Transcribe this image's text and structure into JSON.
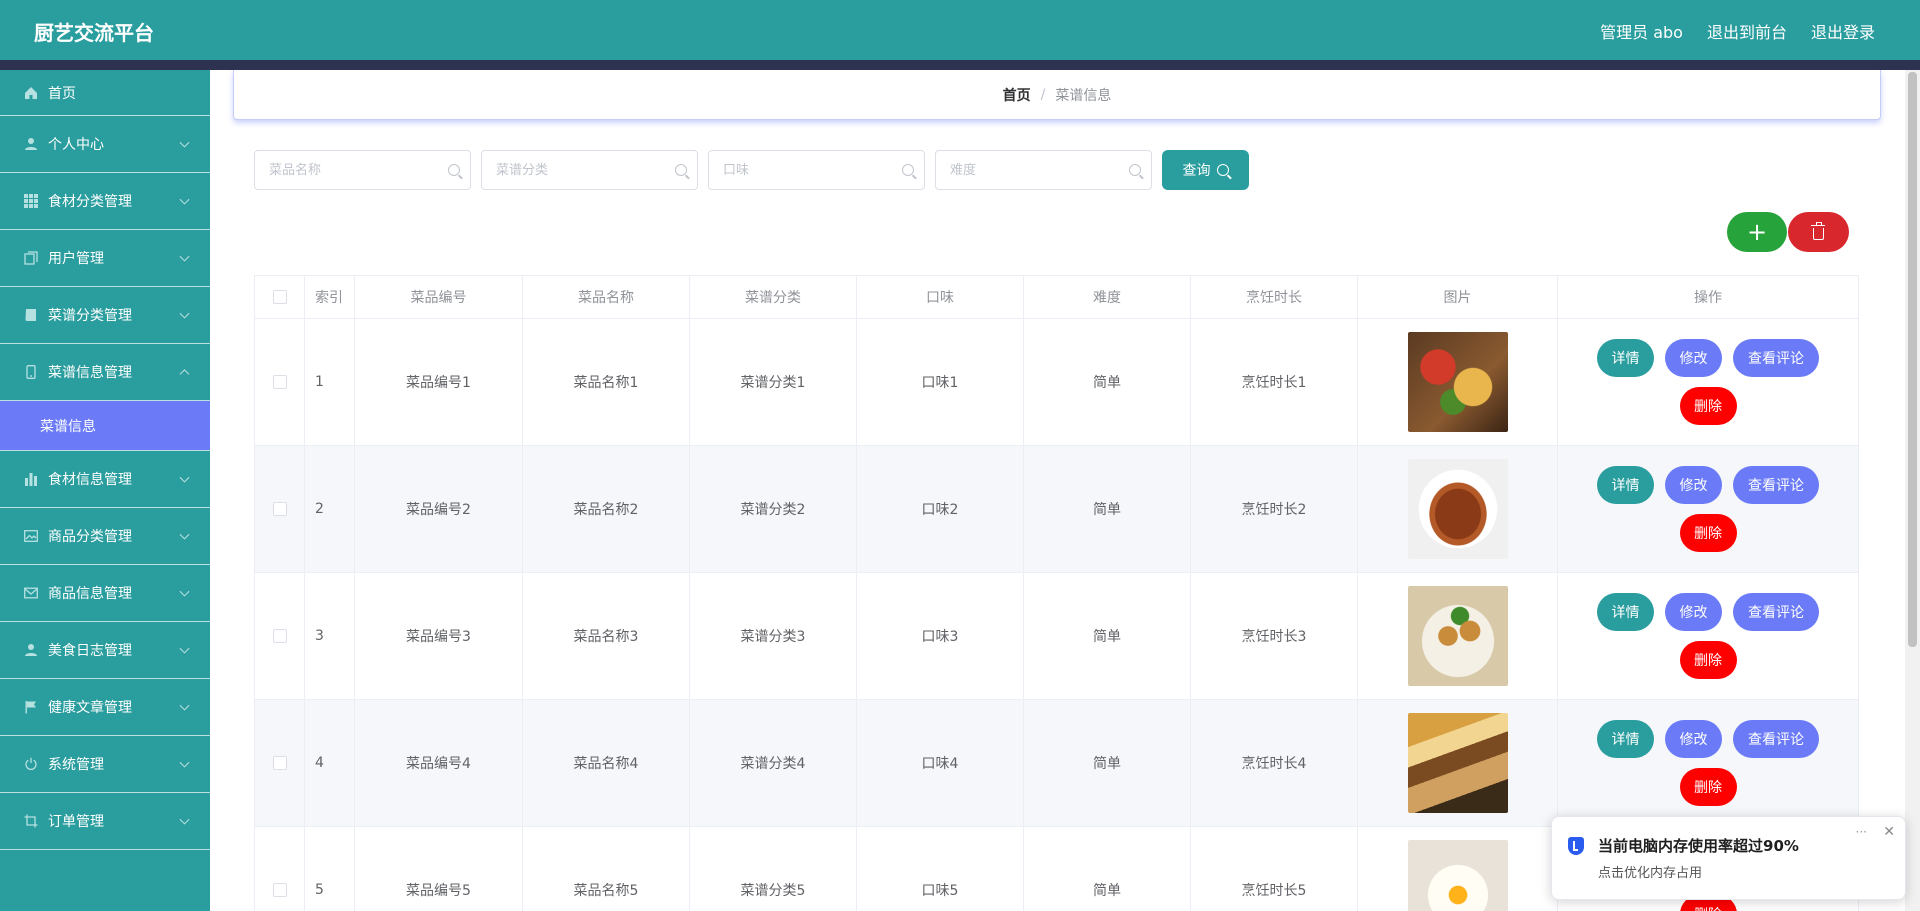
{
  "header": {
    "brand": "厨艺交流平台",
    "user": "管理员 abo",
    "to_front": "退出到前台",
    "logout": "退出登录"
  },
  "sidebar": {
    "items": [
      {
        "label": "首页",
        "icon": "home-icon"
      },
      {
        "label": "个人中心",
        "icon": "user-icon"
      },
      {
        "label": "食材分类管理",
        "icon": "grid-icon"
      },
      {
        "label": "用户管理",
        "icon": "copy-icon"
      },
      {
        "label": "菜谱分类管理",
        "icon": "book-icon"
      },
      {
        "label": "菜谱信息管理",
        "icon": "phone-icon"
      },
      {
        "label": "菜谱信息",
        "icon": ""
      },
      {
        "label": "食材信息管理",
        "icon": "bar-chart-icon"
      },
      {
        "label": "商品分类管理",
        "icon": "image-icon"
      },
      {
        "label": "商品信息管理",
        "icon": "mail-icon"
      },
      {
        "label": "美食日志管理",
        "icon": "user-icon"
      },
      {
        "label": "健康文章管理",
        "icon": "flag-icon"
      },
      {
        "label": "系统管理",
        "icon": "power-icon"
      },
      {
        "label": "订单管理",
        "icon": "crop-icon"
      }
    ]
  },
  "breadcrumb": {
    "home": "首页",
    "sep": "/",
    "current": "菜谱信息"
  },
  "search": {
    "name_placeholder": "菜品名称",
    "category_placeholder": "菜谱分类",
    "taste_placeholder": "口味",
    "difficulty_placeholder": "难度",
    "query_label": "查询"
  },
  "actions": {
    "add_label": "+"
  },
  "table": {
    "headers": [
      "索引",
      "菜品编号",
      "菜品名称",
      "菜谱分类",
      "口味",
      "难度",
      "烹饪时长",
      "图片",
      "操作"
    ],
    "rows": [
      {
        "index": "1",
        "code": "菜品编号1",
        "name": "菜品名称1",
        "category": "菜谱分类1",
        "taste": "口味1",
        "difficulty": "简单",
        "duration": "烹饪时长1"
      },
      {
        "index": "2",
        "code": "菜品编号2",
        "name": "菜品名称2",
        "category": "菜谱分类2",
        "taste": "口味2",
        "difficulty": "简单",
        "duration": "烹饪时长2"
      },
      {
        "index": "3",
        "code": "菜品编号3",
        "name": "菜品名称3",
        "category": "菜谱分类3",
        "taste": "口味3",
        "difficulty": "简单",
        "duration": "烹饪时长3"
      },
      {
        "index": "4",
        "code": "菜品编号4",
        "name": "菜品名称4",
        "category": "菜谱分类4",
        "taste": "口味4",
        "difficulty": "简单",
        "duration": "烹饪时长4"
      },
      {
        "index": "5",
        "code": "菜品编号5",
        "name": "菜品名称5",
        "category": "菜谱分类5",
        "taste": "口味5",
        "difficulty": "简单",
        "duration": "烹饪时长5"
      }
    ],
    "ops": {
      "detail": "详情",
      "edit": "修改",
      "comment": "查看评论",
      "delete": "删除"
    }
  },
  "toast": {
    "title": "当前电脑内存使用率超过90%",
    "subtitle": "点击优化内存占用",
    "more": "···",
    "close": "✕"
  },
  "colors": {
    "primary": "#2a9d9e",
    "accent": "#6b7bf7",
    "success": "#27a33c",
    "danger": "#d9272e",
    "delete": "#ff0000"
  }
}
